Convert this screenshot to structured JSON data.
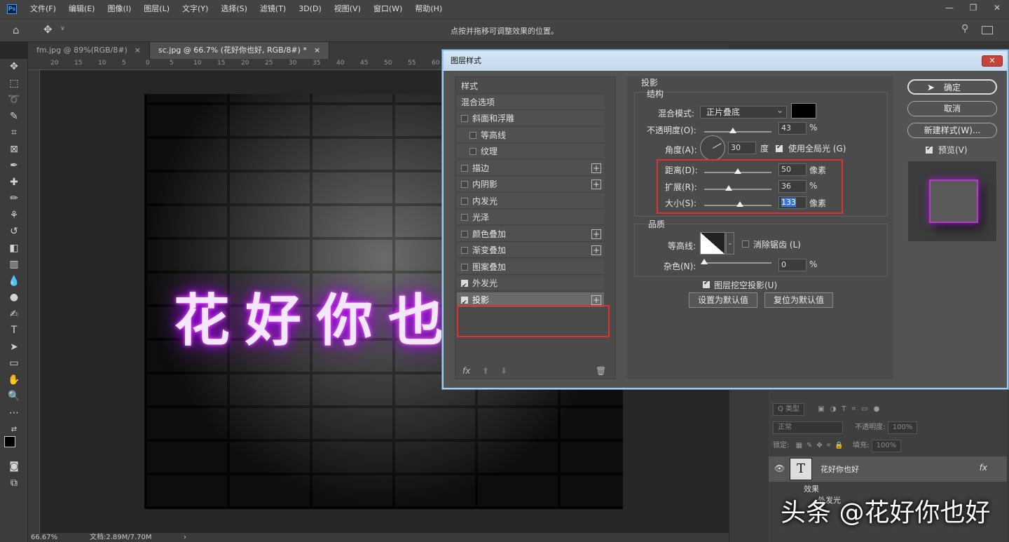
{
  "menubar": {
    "items": [
      "文件(F)",
      "编辑(E)",
      "图像(I)",
      "图层(L)",
      "文字(Y)",
      "选择(S)",
      "滤镜(T)",
      "3D(D)",
      "视图(V)",
      "窗口(W)",
      "帮助(H)"
    ],
    "logo": "Ps"
  },
  "options_bar": {
    "hint": "点按并拖移可调整效果的位置。"
  },
  "tabs": [
    {
      "label": "fm.jpg @ 89%(RGB/8#)",
      "close": "×"
    },
    {
      "label": "sc.jpg @ 66.7% (花好你也好, RGB/8#) *",
      "close": "×"
    }
  ],
  "ruler_top": [
    "20",
    "15",
    "10",
    "5",
    "0",
    "5",
    "10",
    "15",
    "20",
    "25",
    "30",
    "35",
    "40",
    "45",
    "50",
    "55",
    "60"
  ],
  "canvas": {
    "neon_text": "花好你也"
  },
  "status": {
    "zoom": "66.67%",
    "doc": "文档:2.89M/7.70M",
    "arrow": "›"
  },
  "layers_panel": {
    "filter": "Q 类型",
    "blend": "正常",
    "opacity_label": "不透明度:",
    "opacity": "100%",
    "lock_label": "锁定:",
    "fill_label": "填充:",
    "fill": "100%",
    "layer_name": "花好你也好",
    "layer_fx": "fx",
    "effects_label": "效果",
    "effect_1": "外发光",
    "thumb": "T"
  },
  "watermark": "头条 @花好你也好",
  "dialog": {
    "title": "图层样式",
    "close": "✕",
    "style_list": {
      "header": "样式",
      "blend_options": "混合选项",
      "items": [
        {
          "label": "斜面和浮雕",
          "checked": false,
          "plus": false,
          "indent": false
        },
        {
          "label": "等高线",
          "checked": false,
          "plus": false,
          "indent": true
        },
        {
          "label": "纹理",
          "checked": false,
          "plus": false,
          "indent": true
        },
        {
          "label": "描边",
          "checked": false,
          "plus": true,
          "indent": false
        },
        {
          "label": "内阴影",
          "checked": false,
          "plus": true,
          "indent": false
        },
        {
          "label": "内发光",
          "checked": false,
          "plus": false,
          "indent": false
        },
        {
          "label": "光泽",
          "checked": false,
          "plus": false,
          "indent": false
        },
        {
          "label": "颜色叠加",
          "checked": false,
          "plus": true,
          "indent": false
        },
        {
          "label": "渐变叠加",
          "checked": false,
          "plus": true,
          "indent": false
        },
        {
          "label": "图案叠加",
          "checked": false,
          "plus": false,
          "indent": false
        },
        {
          "label": "外发光",
          "checked": true,
          "plus": false,
          "indent": false
        },
        {
          "label": "投影",
          "checked": true,
          "plus": true,
          "indent": false,
          "selected": true
        }
      ],
      "footer": {
        "fx": "fx",
        "up": "⬆",
        "down": "⬇",
        "trash": "🗑"
      }
    },
    "drop_shadow": {
      "section": "投影",
      "structure": "结构",
      "blend_mode_label": "混合模式:",
      "blend_mode": "正片叠底",
      "color": "#000000",
      "opacity_label": "不透明度(O):",
      "opacity": "43",
      "opacity_unit": "%",
      "opacity_level": 0.43,
      "angle_label": "角度(A):",
      "angle": "30",
      "angle_unit": "度",
      "global_light": "使用全局光 (G)",
      "distance_label": "距离(D):",
      "distance": "50",
      "distance_unit": "像素",
      "distance_level": 0.5,
      "spread_label": "扩展(R):",
      "spread": "36",
      "spread_unit": "%",
      "spread_level": 0.36,
      "size_label": "大小(S):",
      "size": "133",
      "size_unit": "像素",
      "size_level": 0.53,
      "quality": "品质",
      "contour_label": "等高线:",
      "anti_alias": "消除锯齿 (L)",
      "noise_label": "杂色(N):",
      "noise": "0",
      "noise_unit": "%",
      "noise_level": 0,
      "knockout": "图层挖空投影(U)",
      "set_default": "设置为默认值",
      "reset_default": "复位为默认值"
    },
    "buttons": {
      "ok": "确定",
      "cancel": "取消",
      "new_style": "新建样式(W)...",
      "preview": "预览(V)"
    }
  }
}
